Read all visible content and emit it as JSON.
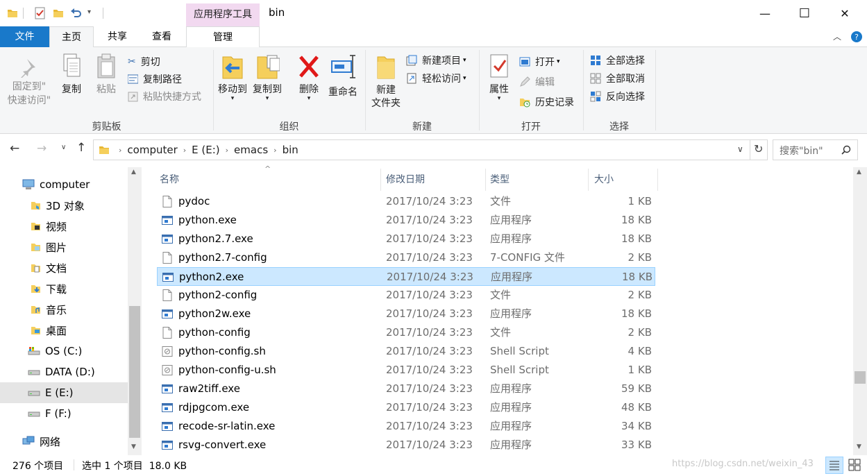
{
  "window": {
    "title": "bin",
    "context_tab": "应用程序工具",
    "minimize": "—",
    "maximize": "☐",
    "close": "✕"
  },
  "tabs": {
    "file": "文件",
    "home": "主页",
    "share": "共享",
    "view": "查看",
    "manage": "管理"
  },
  "ribbon": {
    "clipboard": {
      "pin_line1": "固定到\"",
      "pin_line2": "快速访问\"",
      "copy": "复制",
      "paste": "粘贴",
      "cut": "剪切",
      "copy_path": "复制路径",
      "paste_shortcut": "粘贴快捷方式",
      "group": "剪贴板"
    },
    "organize": {
      "move_to": "移动到",
      "copy_to": "复制到",
      "delete": "删除",
      "rename": "重命名",
      "group": "组织"
    },
    "new": {
      "new_folder_line1": "新建",
      "new_folder_line2": "文件夹",
      "new_item": "新建项目",
      "easy_access": "轻松访问",
      "group": "新建"
    },
    "open": {
      "properties": "属性",
      "open": "打开",
      "edit": "编辑",
      "history": "历史记录",
      "group": "打开"
    },
    "select": {
      "select_all": "全部选择",
      "select_none": "全部取消",
      "invert": "反向选择",
      "group": "选择"
    }
  },
  "address": {
    "crumbs": [
      "computer",
      "E (E:)",
      "emacs",
      "bin"
    ],
    "search_placeholder": "搜索\"bin\""
  },
  "nav": {
    "items": [
      {
        "label": "computer",
        "icon": "computer-icon"
      },
      {
        "label": "3D 对象",
        "icon": "3d-objects-icon"
      },
      {
        "label": "视频",
        "icon": "videos-icon"
      },
      {
        "label": "图片",
        "icon": "pictures-icon"
      },
      {
        "label": "文档",
        "icon": "documents-icon"
      },
      {
        "label": "下载",
        "icon": "downloads-icon"
      },
      {
        "label": "音乐",
        "icon": "music-icon"
      },
      {
        "label": "桌面",
        "icon": "desktop-icon"
      },
      {
        "label": "OS (C:)",
        "icon": "os-drive-icon"
      },
      {
        "label": "DATA (D:)",
        "icon": "drive-icon"
      },
      {
        "label": "E (E:)",
        "icon": "drive-icon"
      },
      {
        "label": "F (F:)",
        "icon": "drive-icon"
      },
      {
        "label": "网络",
        "icon": "network-icon"
      }
    ]
  },
  "columns": {
    "name": "名称",
    "date": "修改日期",
    "type": "类型",
    "size": "大小"
  },
  "files": [
    {
      "name": "pydoc",
      "date": "2017/10/24 3:23",
      "type": "文件",
      "size": "1 KB",
      "icon": "file-icon"
    },
    {
      "name": "python.exe",
      "date": "2017/10/24 3:23",
      "type": "应用程序",
      "size": "18 KB",
      "icon": "exe-icon"
    },
    {
      "name": "python2.7.exe",
      "date": "2017/10/24 3:23",
      "type": "应用程序",
      "size": "18 KB",
      "icon": "exe-icon"
    },
    {
      "name": "python2.7-config",
      "date": "2017/10/24 3:23",
      "type": "7-CONFIG 文件",
      "size": "2 KB",
      "icon": "file-icon"
    },
    {
      "name": "python2.exe",
      "date": "2017/10/24 3:23",
      "type": "应用程序",
      "size": "18 KB",
      "icon": "exe-icon",
      "selected": true
    },
    {
      "name": "python2-config",
      "date": "2017/10/24 3:23",
      "type": "文件",
      "size": "2 KB",
      "icon": "file-icon"
    },
    {
      "name": "python2w.exe",
      "date": "2017/10/24 3:23",
      "type": "应用程序",
      "size": "18 KB",
      "icon": "exe-icon"
    },
    {
      "name": "python-config",
      "date": "2017/10/24 3:23",
      "type": "文件",
      "size": "2 KB",
      "icon": "file-icon"
    },
    {
      "name": "python-config.sh",
      "date": "2017/10/24 3:23",
      "type": "Shell Script",
      "size": "4 KB",
      "icon": "script-icon"
    },
    {
      "name": "python-config-u.sh",
      "date": "2017/10/24 3:23",
      "type": "Shell Script",
      "size": "1 KB",
      "icon": "script-icon"
    },
    {
      "name": "raw2tiff.exe",
      "date": "2017/10/24 3:23",
      "type": "应用程序",
      "size": "59 KB",
      "icon": "exe-icon"
    },
    {
      "name": "rdjpgcom.exe",
      "date": "2017/10/24 3:23",
      "type": "应用程序",
      "size": "48 KB",
      "icon": "exe-icon"
    },
    {
      "name": "recode-sr-latin.exe",
      "date": "2017/10/24 3:23",
      "type": "应用程序",
      "size": "34 KB",
      "icon": "exe-icon"
    },
    {
      "name": "rsvg-convert.exe",
      "date": "2017/10/24 3:23",
      "type": "应用程序",
      "size": "33 KB",
      "icon": "exe-icon"
    }
  ],
  "status": {
    "count": "276 个项目",
    "selection": "选中 1 个项目  18.0 KB",
    "watermark": "https://blog.csdn.net/weixin_43"
  },
  "colors": {
    "accent": "#1979ca",
    "selection": "#cce8ff",
    "context_tab": "#f2d9f0"
  }
}
